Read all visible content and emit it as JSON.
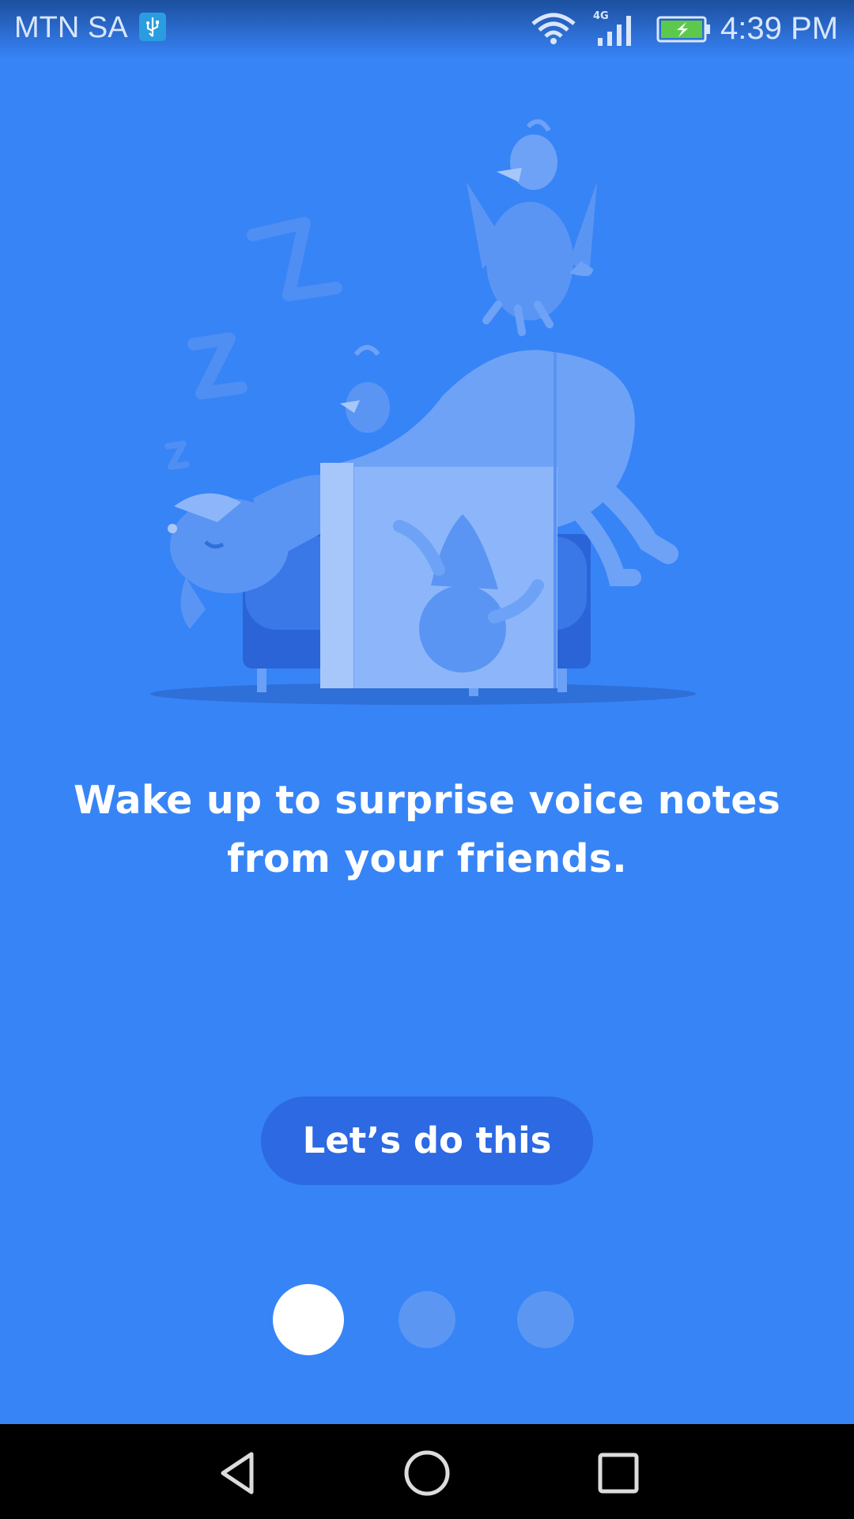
{
  "status_bar": {
    "carrier": "MTN SA",
    "network_type": "4G",
    "time": "4:39 PM",
    "icons": [
      "usb-debugging-icon",
      "wifi-icon",
      "cellular-signal-icon",
      "battery-charging-icon"
    ]
  },
  "onboarding": {
    "illustration": "sleeping-birds-on-couch-illustration",
    "headline": "Wake up to surprise voice notes from your friends.",
    "cta_label": "Let’s do this",
    "page_indicator": {
      "current": 1,
      "total": 3
    }
  },
  "nav_bar": {
    "icons": [
      "back-icon",
      "home-icon",
      "recents-icon"
    ]
  },
  "colors": {
    "background": "#3784f7",
    "button": "#2c69e2",
    "dot_active": "#ffffff",
    "dot_inactive": "#5b97f2"
  }
}
